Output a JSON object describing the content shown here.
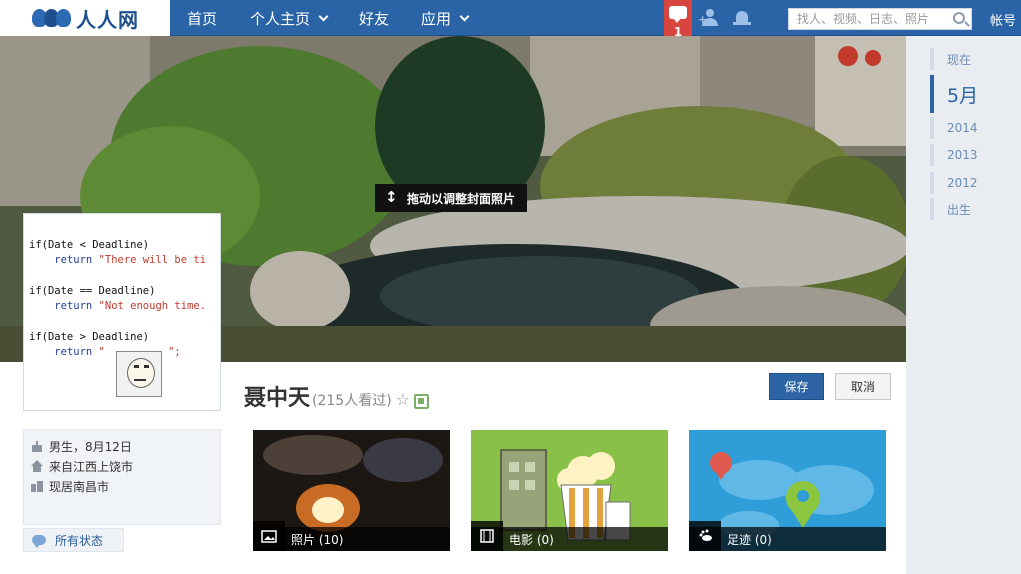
{
  "topbar": {
    "logo_text": "人人网",
    "nav": [
      {
        "label": "首页"
      },
      {
        "label": "个人主页"
      },
      {
        "label": "好友"
      },
      {
        "label": "应用"
      }
    ],
    "message_count": "1",
    "search_placeholder": "找人、视频、日志、照片",
    "account_label": "帐号"
  },
  "cover": {
    "hint": "拖动以调整封面照片"
  },
  "avatar": {
    "code_lines": [
      {
        "a": "if(Date < Deadline)",
        "b": "",
        "c": ""
      },
      {
        "a": "    ",
        "b": "return",
        "c": " \"There will be ti"
      },
      {
        "a": "",
        "b": "",
        "c": ""
      },
      {
        "a": "if(Date == Deadline)",
        "b": "",
        "c": ""
      },
      {
        "a": "    ",
        "b": "return",
        "c": " \"Not enough time."
      },
      {
        "a": "",
        "b": "",
        "c": ""
      },
      {
        "a": "if(Date > Deadline)",
        "b": "",
        "c": ""
      },
      {
        "a": "    ",
        "b": "return",
        "c": " \"          \";"
      }
    ]
  },
  "profile": {
    "name": "聂中天",
    "views": "(215人看过)",
    "save_label": "保存",
    "cancel_label": "取消"
  },
  "info": {
    "birthday": "男生，8月12日",
    "hometown": "来自江西上饶市",
    "residence": "现居南昌市"
  },
  "status_link": "所有状态",
  "tiles": [
    {
      "label": "照片 (10)",
      "icon": "photo-icon"
    },
    {
      "label": "电影 (0)",
      "icon": "film-icon"
    },
    {
      "label": "足迹 (0)",
      "icon": "footprint-icon"
    }
  ],
  "timeline": [
    {
      "label": "现在"
    },
    {
      "label": "5月"
    },
    {
      "label": "2014"
    },
    {
      "label": "2013"
    },
    {
      "label": "2012"
    },
    {
      "label": "出生"
    }
  ],
  "colors": {
    "brand_blue": "#2a64a6",
    "message_red": "#d8453e",
    "save_blue": "#2c64a6"
  }
}
